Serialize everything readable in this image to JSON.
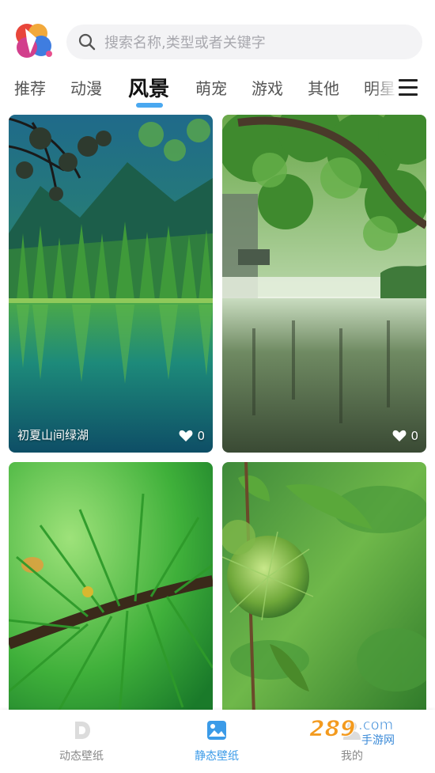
{
  "search": {
    "placeholder": "搜索名称,类型或者关键字",
    "icon": "search-icon"
  },
  "app": {
    "logo_icon": "app-logo-icon"
  },
  "tabs": [
    {
      "label": "推荐",
      "active": false
    },
    {
      "label": "动漫",
      "active": false
    },
    {
      "label": "风景",
      "active": true
    },
    {
      "label": "萌宠",
      "active": false
    },
    {
      "label": "游戏",
      "active": false
    },
    {
      "label": "其他",
      "active": false
    },
    {
      "label": "明星",
      "active": false
    }
  ],
  "menu": {
    "icon": "menu-icon"
  },
  "accent_color": "#4aa8f0",
  "wallpapers": [
    {
      "title": "初夏山间绿湖",
      "likes": "0"
    },
    {
      "title": "",
      "likes": "0"
    },
    {
      "title": "",
      "likes": ""
    },
    {
      "title": "",
      "likes": ""
    }
  ],
  "bottom_nav": [
    {
      "label": "动态壁纸",
      "icon": "dynamic-wallpaper-icon",
      "active": false
    },
    {
      "label": "静态壁纸",
      "icon": "static-wallpaper-icon",
      "active": true
    },
    {
      "label": "我的",
      "icon": "profile-icon",
      "active": false
    }
  ],
  "watermark": {
    "text": "289.com",
    "subtext": "手游网"
  }
}
